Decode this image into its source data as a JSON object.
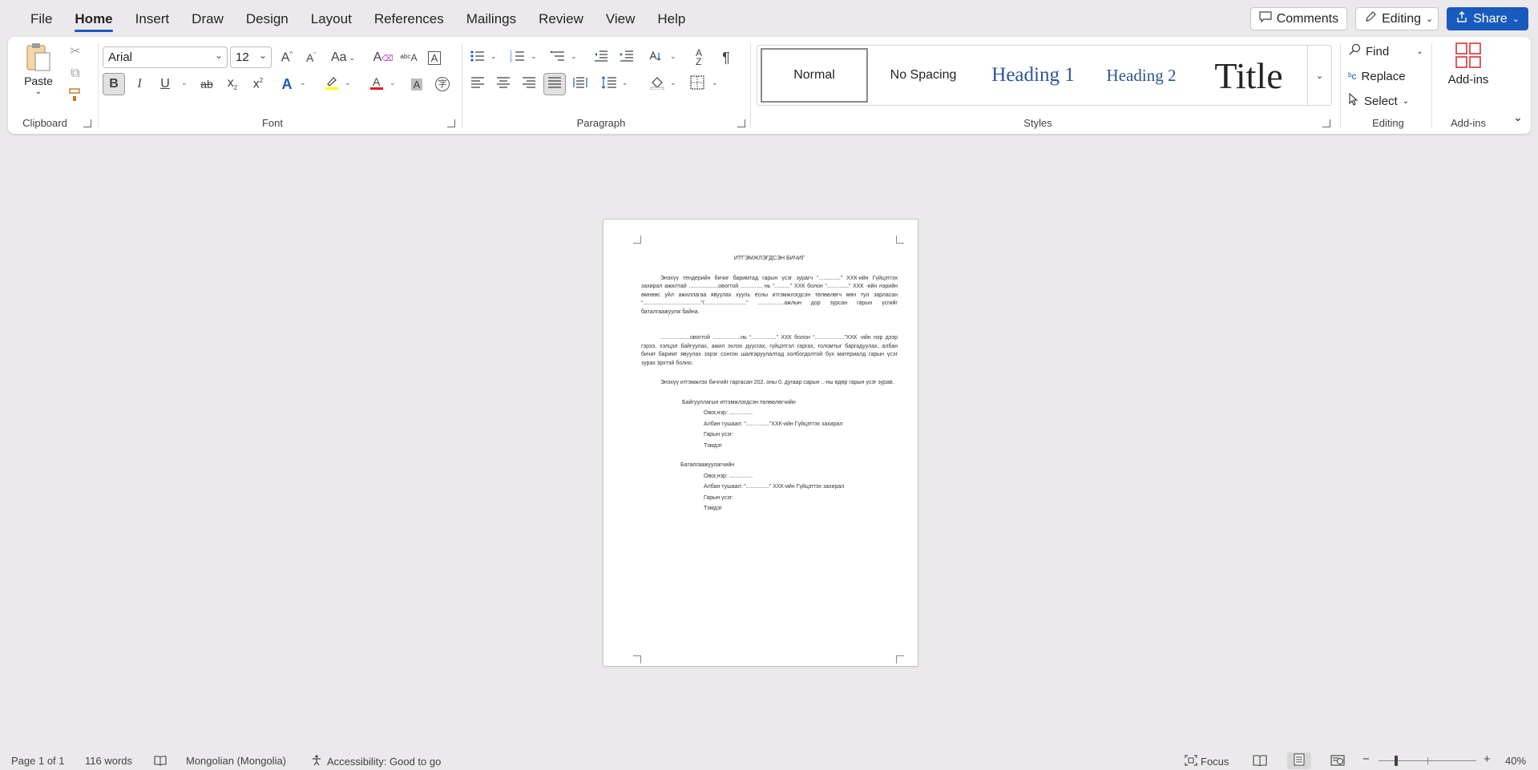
{
  "menu": {
    "tabs": [
      "File",
      "Home",
      "Insert",
      "Draw",
      "Design",
      "Layout",
      "References",
      "Mailings",
      "Review",
      "View",
      "Help"
    ],
    "active": "Home",
    "comments_label": "Comments",
    "editing_label": "Editing",
    "share_label": "Share"
  },
  "ribbon": {
    "clipboard": {
      "paste_label": "Paste",
      "group_label": "Clipboard"
    },
    "font": {
      "font_name": "Arial",
      "font_size": "12",
      "case_label": "Aa",
      "group_label": "Font"
    },
    "paragraph": {
      "group_label": "Paragraph"
    },
    "styles": {
      "items": [
        "Normal",
        "No Spacing",
        "Heading 1",
        "Heading 2",
        "Title"
      ],
      "group_label": "Styles"
    },
    "editing": {
      "find_label": "Find",
      "replace_label": "Replace",
      "select_label": "Select",
      "group_label": "Editing"
    },
    "addins": {
      "button_label": "Add-ins",
      "group_label": "Add-ins"
    },
    "colors": {
      "highlight": "#ffff00",
      "font_color": "#e81123",
      "accent": "#185abd"
    }
  },
  "document": {
    "title": "ИТГЭМЖЛЭГДСЭН БИЧИГ",
    "para1": "Энэхүү тендерийн бичиг баримтад гарын үсэг зурагч “..............” ХХК-ийн Гүйцэтгэх захирал ажилтай ...................овогтой .............. нь “..........” ХХК болон “..............” ХХК -ийн нэрийн өмнөөс уйл ажиллагаа явуулах хууль ёсны итгэмжлэгдсэн төлөөлөгч мөн тул зарласан “.....................................”/...........................” .................ажлын дор зурсан гарын үсгийг баталгаажуулж байна.",
    "para2": "...................овогтой ..................нь “................” ХХК болон “...................”ХХК -ийн нэр дээр гэрээ, хэлцэл байгуулах, ажил эхлэх дуусгах, гүйцэтгэл гаргах, голомтыг баргадуулах, албан бичиг баримт явуулах зэрэг сонгон шалгаруулалтад холбогдолтой бүх материалд гарын үсэг зурах эрхтэй болно.",
    "para3": "Энэхүү итгэмжлэх бичгийг гаргасан 202. оны 0. дугаар сарын ..-ны өдөр гарын үсэг зурав.",
    "sig1_title": "Байгууллагын итгэмжлэгдсэн төлөөлөгчийн",
    "sig1_name": "Овог,нэр: ...............",
    "sig1_position": "Албан тушаал: “...............”ХХК-ийн Гүйцэтгэх захирал",
    "sig1_signature": "Гарын үсэг:",
    "sig1_seal": "Тэмдэг",
    "sig2_title": "Баталгаажуулагчийн",
    "sig2_name": "Овог,нэр: ...............",
    "sig2_position": "Албан тушаал: “...............” ХХК-ийн Гүйцэтгэх захирал",
    "sig2_signature": "Гарын үсэг:",
    "sig2_seal": "Тэмдэг"
  },
  "status": {
    "page": "Page 1 of 1",
    "words": "116 words",
    "language": "Mongolian (Mongolia)",
    "accessibility": "Accessibility: Good to go",
    "focus": "Focus",
    "zoom": "40%"
  }
}
